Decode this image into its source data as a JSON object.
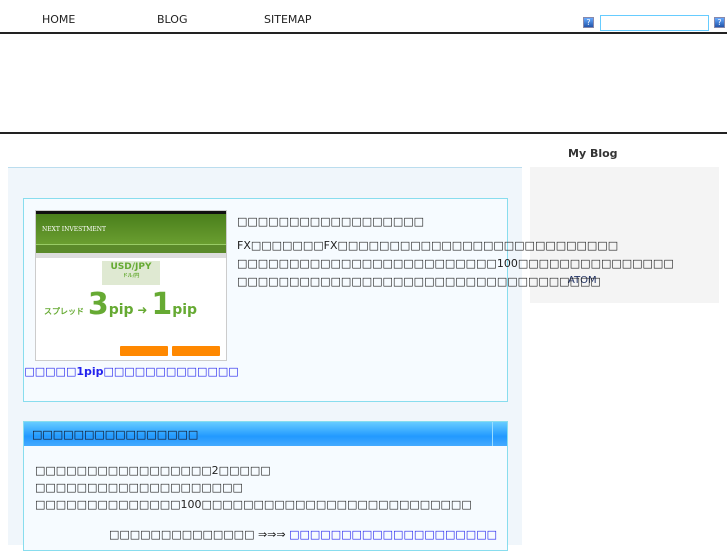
{
  "nav": {
    "items": [
      "HOME",
      "BLOG",
      "SITEMAP"
    ]
  },
  "search": {
    "value": "",
    "icon_left": "?",
    "icon_right": "?"
  },
  "sidebar": {
    "title": "My Blog",
    "atom": "ATOM"
  },
  "feature": {
    "heading": "□□□□□□□□□□□□□□□□□□",
    "lines": [
      "FX□□□□□□□FX□□□□□□□□□□□□□□□□□□□□□□□□□□□",
      "□□□□□□□□□□□□□□□□□□□□□□□□□100□□□□□□□□□□□□□□□",
      "□□□□□□□□□□□□□□□□□□□□□□□□□□□□□□□□□□□"
    ],
    "caption": "□□□□□1pip□□□□□□□□□□□□□",
    "image": {
      "brand": "NEXT INVESTMENT",
      "pair": "USD/JPY",
      "pair_sub": "ドル/円",
      "spread": "スプレッド",
      "from": "3",
      "to": "1",
      "unit": "pip"
    }
  },
  "info": {
    "title": "□□□□□□□□□□□□□□□□",
    "lines": [
      "□□□□□□□□□□□□□□□□□2□□□□□",
      "□□□□□□□□□□□□□□□□□□□□",
      "□□□□□□□□□□□□□□100□□□□□□□□□□□□□□□□□□□□□□□□□□"
    ],
    "more_label": "□□□□□□□□□□□□□□ ⇒⇒⇒",
    "more_link": "□□□□□□□□□□□□□□□□□□□□"
  }
}
